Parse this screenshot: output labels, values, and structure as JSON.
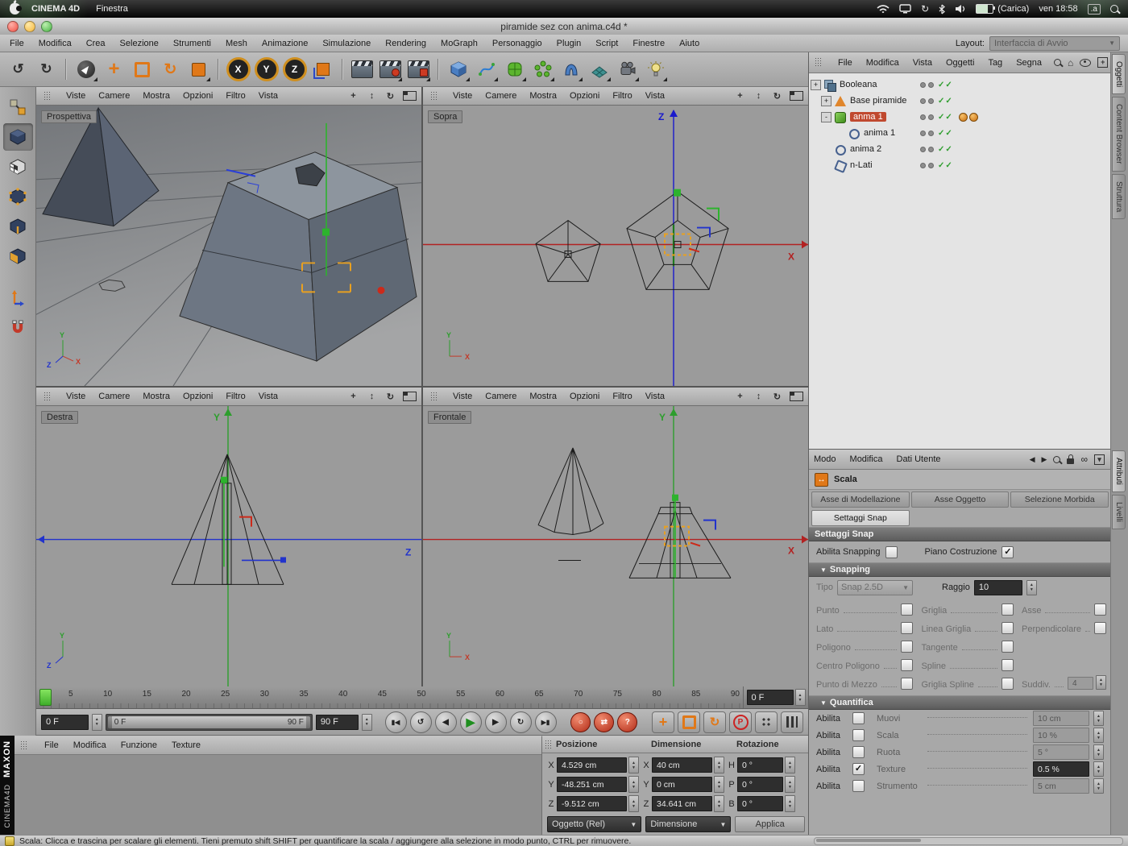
{
  "mac_menubar": {
    "app_name": "CINEMA 4D",
    "menus": [
      "Finestra"
    ],
    "battery_label": "(Carica)",
    "clock": "ven 18:58",
    "input_label": ".a"
  },
  "window": {
    "title": "piramide sez con anima.c4d *"
  },
  "app_menubar": {
    "items": [
      "File",
      "Modifica",
      "Crea",
      "Selezione",
      "Strumenti",
      "Mesh",
      "Animazione",
      "Simulazione",
      "Rendering",
      "MoGraph",
      "Personaggio",
      "Plugin",
      "Script",
      "Finestre",
      "Aiuto"
    ],
    "layout_label": "Layout:",
    "layout_value": "Interfaccia di Avvio"
  },
  "toolbar": {
    "axis_locks": [
      "X",
      "Y",
      "Z"
    ],
    "glyphs": {
      "undo": "↺",
      "redo": "↻",
      "move": "+",
      "rotate": "↻"
    },
    "icons": [
      "undo",
      "redo",
      "live-selection",
      "move",
      "scale",
      "rotate",
      "last-tool",
      "lock-x",
      "lock-y",
      "lock-z",
      "coordinate-system",
      "render-view",
      "render-picture-viewer",
      "render-settings",
      "add-cube",
      "freehand-spline",
      "subdivision-surface",
      "array",
      "deformer",
      "floor",
      "camera",
      "light"
    ]
  },
  "tool_palette": {
    "icons": [
      "make-editable",
      "model-mode",
      "texture-mode",
      "points-mode",
      "edges-mode",
      "polygons-mode",
      "axis-mode",
      "snap-settings"
    ]
  },
  "viewports": {
    "menu": [
      "Viste",
      "Camere",
      "Mostra",
      "Opzioni",
      "Filtro",
      "Vista"
    ],
    "header_icons": {
      "pan": "+",
      "zoom": "↕",
      "rotate": "↻"
    },
    "panes": {
      "tl": {
        "label": "Prospettiva"
      },
      "tr": {
        "label": "Sopra",
        "v_axis": "Z",
        "h_axis": "X"
      },
      "bl": {
        "label": "Destra",
        "v_axis": "Y",
        "h_axis": "Z"
      },
      "br": {
        "label": "Frontale",
        "v_axis": "Y",
        "h_axis": "X"
      }
    },
    "mini_axis": {
      "x": "X",
      "y": "Y",
      "z": "Z"
    }
  },
  "timeline": {
    "ticks": [
      5,
      10,
      15,
      20,
      25,
      30,
      35,
      40,
      45,
      50,
      55,
      60,
      65,
      70,
      75,
      80,
      85,
      90
    ],
    "frame_field": "0 F"
  },
  "transport": {
    "current_frame": "0 F",
    "range_start": "0 F",
    "range_end": "90 F",
    "end_frame": "90 F",
    "glyphs": {
      "go_start": "▮◀",
      "play_reverse": "↺",
      "prev_frame": "◀",
      "play": "▶",
      "next_frame": "▶",
      "loop": "↻",
      "go_end": "▶▮",
      "record_key": "○",
      "autokey": "⇄",
      "help": "?",
      "param": "P"
    }
  },
  "object_manager": {
    "menu": [
      "File",
      "Modifica",
      "Vista",
      "Oggetti",
      "Tag",
      "Segna"
    ],
    "tree": [
      {
        "label": "Booleana",
        "pad": 2,
        "expander": "+",
        "icon": "boole-icon"
      },
      {
        "label": "Base piramide",
        "pad": 15,
        "expander": "+",
        "icon": "pyramid-icon"
      },
      {
        "label": "anma 1",
        "pad": 15,
        "expander": "-",
        "icon": "sweep-icon",
        "selected": true,
        "tags": true
      },
      {
        "label": "anima 1",
        "pad": 32,
        "expander": "",
        "icon": "spline-circle-icon"
      },
      {
        "label": "anima 2",
        "pad": 15,
        "expander": "",
        "icon": "spline-circle-icon"
      },
      {
        "label": "n-Lati",
        "pad": 15,
        "expander": "",
        "icon": "nside-icon"
      }
    ]
  },
  "attributes": {
    "menu": [
      "Modo",
      "Modifica",
      "Dati Utente"
    ],
    "tool_name": "Scala",
    "tabs": [
      {
        "label": "Asse di Modellazione"
      },
      {
        "label": "Asse Oggetto"
      },
      {
        "label": "Selezione Morbida"
      }
    ],
    "active_tab": "Settaggi Snap",
    "section_title": "Settaggi Snap",
    "enable_snapping_label": "Abilita Snapping",
    "construction_plane_label": "Piano Costruzione",
    "snapping_group": "Snapping",
    "tipo_label": "Tipo",
    "tipo_value": "Snap 2.5D",
    "raggio_label": "Raggio",
    "raggio_value": "10",
    "snap_options": {
      "col1": [
        "Punto",
        "Lato",
        "Poligono",
        "Centro Poligono",
        "Punto di Mezzo"
      ],
      "col2": [
        "Griglia",
        "Linea Griglia",
        "Tangente",
        "Spline",
        "Griglia Spline"
      ],
      "col3": {
        "r1": "Asse",
        "r2": "Perpendicolare",
        "r5": "Suddiv.",
        "r5_value": "4"
      }
    },
    "quantize_group": "Quantifica",
    "quantize": {
      "rows": [
        {
          "enable_label": "Abilita",
          "checked": false,
          "label": "Muovi",
          "value": "10 cm",
          "enabled": false
        },
        {
          "enable_label": "Abilita",
          "checked": false,
          "label": "Scala",
          "value": "10 %",
          "enabled": false
        },
        {
          "enable_label": "Abilita",
          "checked": false,
          "label": "Ruota",
          "value": "5 °",
          "enabled": false
        },
        {
          "enable_label": "Abilita",
          "checked": true,
          "label": "Texture",
          "value": "0.5 %",
          "enabled": true
        },
        {
          "enable_label": "Abilita",
          "checked": false,
          "label": "Strumento",
          "value": "5 cm",
          "enabled": false
        }
      ]
    }
  },
  "coordinates": {
    "headers": [
      "Posizione",
      "Dimensione",
      "Rotazione"
    ],
    "position": [
      {
        "axis": "X",
        "value": "4.529 cm"
      },
      {
        "axis": "Y",
        "value": "-48.251 cm"
      },
      {
        "axis": "Z",
        "value": "-9.512 cm"
      }
    ],
    "dimension": [
      {
        "axis": "X",
        "value": "40 cm"
      },
      {
        "axis": "Y",
        "value": "0 cm"
      },
      {
        "axis": "Z",
        "value": "34.641 cm"
      }
    ],
    "rotation": [
      {
        "axis": "H",
        "value": "0 °"
      },
      {
        "axis": "P",
        "value": "0 °"
      },
      {
        "axis": "B",
        "value": "0 °"
      }
    ],
    "position_mode": "Oggetto (Rel)",
    "dimension_mode": "Dimensione",
    "apply_label": "Applica"
  },
  "material_manager": {
    "menu": [
      "File",
      "Modifica",
      "Funzione",
      "Texture"
    ]
  },
  "branding": {
    "maxon": "MAXON",
    "cinema": "CINEMA4D"
  },
  "side_tabs": {
    "top": [
      {
        "label": "Oggetti",
        "active": true
      },
      {
        "label": "Content Browser",
        "active": false
      },
      {
        "label": "Struttura",
        "active": false
      }
    ],
    "bottom": [
      {
        "label": "Attributi",
        "active": true
      },
      {
        "label": "Livelli",
        "active": false
      }
    ]
  },
  "status_bar": {
    "text": "Scala: Clicca e trascina per scalare gli elementi. Tieni premuto shift SHIFT per quantificare la scala / aggiungere alla selezione in modo punto, CTRL per rimuovere."
  }
}
